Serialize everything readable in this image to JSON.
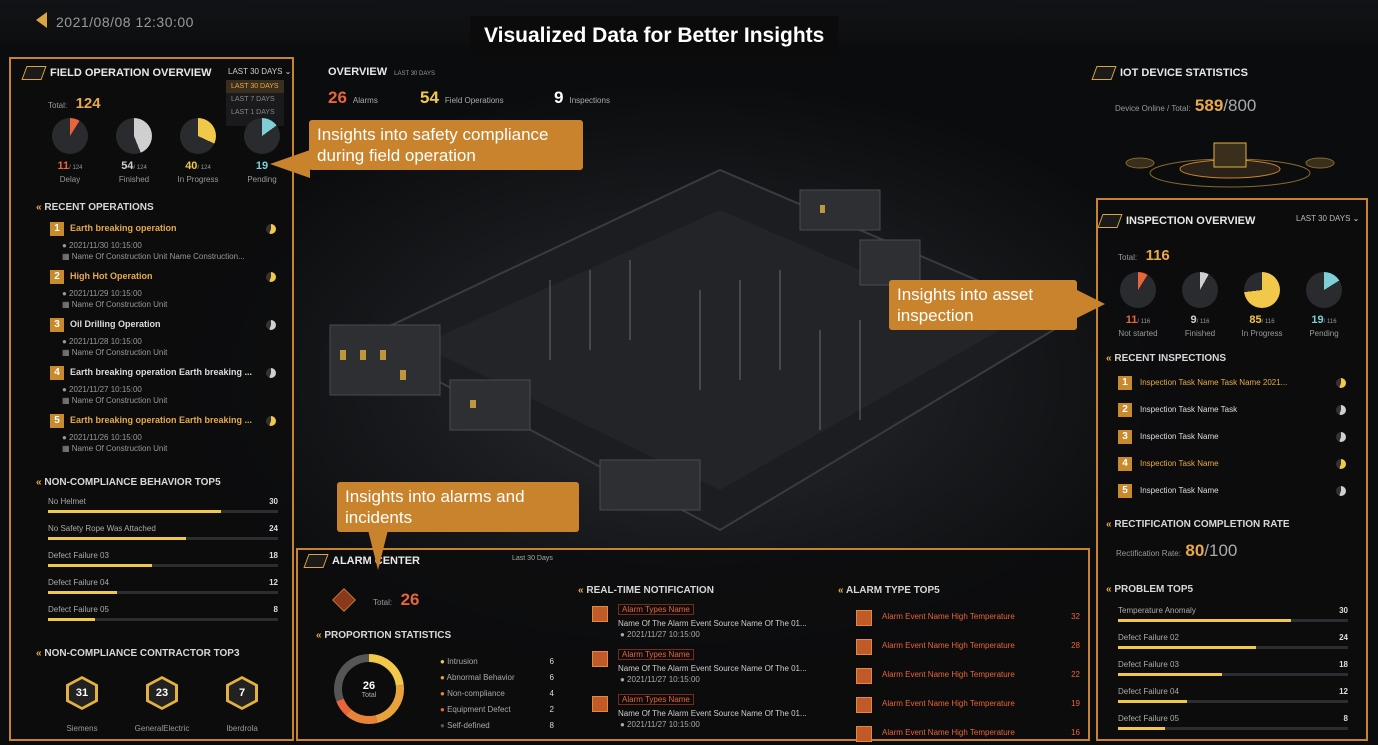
{
  "datetime": "2021/08/08 12:30:00",
  "main_title": "Visualized Data for Better Insights",
  "callouts": {
    "field": "Insights into safety compliance during field operation",
    "asset": "Insights into asset inspection",
    "alarms": "Insights into alarms and incidents"
  },
  "field_operation": {
    "title": "FIELD OPERATION OVERVIEW",
    "period": "LAST 30 DAYS",
    "dropdown_options": [
      "LAST 30 DAYS",
      "LAST 7 DAYS",
      "LAST 1 DAYS"
    ],
    "total_label": "Total:",
    "total": "124",
    "stats": [
      {
        "value": "11",
        "of": "/ 124",
        "label": "Delay",
        "color": "#e8643a",
        "fraction": 0.09
      },
      {
        "value": "54",
        "of": "/ 124",
        "label": "Finished",
        "color": "#cfcfcf",
        "fraction": 0.44
      },
      {
        "value": "40",
        "of": "/ 124",
        "label": "In Progress",
        "color": "#f2c84b",
        "fraction": 0.32
      },
      {
        "value": "19",
        "of": "",
        "label": "Pending",
        "color": "#7fd0d6",
        "fraction": 0.15
      }
    ],
    "recent_title": "RECENT OPERATIONS",
    "recent": [
      {
        "n": "1",
        "name": "Earth breaking operation",
        "time": "2021/11/30 10:15:00",
        "unit": "Name Of Construction Unit Name Construction...",
        "highlight": true
      },
      {
        "n": "2",
        "name": "High Hot Operation",
        "time": "2021/11/29 10:15:00",
        "unit": "Name Of Construction Unit",
        "highlight": true
      },
      {
        "n": "3",
        "name": "Oil Drilling Operation",
        "time": "2021/11/28 10:15:00",
        "unit": "Name Of Construction Unit",
        "highlight": false
      },
      {
        "n": "4",
        "name": "Earth breaking operation Earth breaking ...",
        "time": "2021/11/27 10:15:00",
        "unit": "Name Of Construction Unit",
        "highlight": false
      },
      {
        "n": "5",
        "name": "Earth breaking operation Earth breaking ...",
        "time": "2021/11/26 10:15:00",
        "unit": "Name Of Construction Unit",
        "highlight": true
      }
    ],
    "noncompliance_title": "NON-COMPLIANCE BEHAVIOR TOP5",
    "noncompliance": [
      {
        "label": "No Helmet",
        "value": "30",
        "pct": 1.0
      },
      {
        "label": "No Safety Rope Was Attached",
        "value": "24",
        "pct": 0.8
      },
      {
        "label": "Defect Failure 03",
        "value": "18",
        "pct": 0.6
      },
      {
        "label": "Defect Failure 04",
        "value": "12",
        "pct": 0.4
      },
      {
        "label": "Defect Failure 05",
        "value": "8",
        "pct": 0.27
      }
    ],
    "contractor_title": "NON-COMPLIANCE CONTRACTOR TOP3",
    "contractors": [
      {
        "value": "31",
        "name": "Siemens"
      },
      {
        "value": "23",
        "name": "GeneralElectric"
      },
      {
        "value": "7",
        "name": "Iberdrola"
      }
    ]
  },
  "overview": {
    "title": "OVERVIEW",
    "period": "LAST 30 DAYS",
    "items": [
      {
        "value": "26",
        "label": "Alarms",
        "color": "#e8643a"
      },
      {
        "value": "54",
        "label": "Field Operations",
        "color": "#f2c84b"
      },
      {
        "value": "9",
        "label": "Inspections",
        "color": "#ffffff"
      }
    ]
  },
  "iot": {
    "title": "IOT DEVICE STATISTICS",
    "label": "Device Online / Total:",
    "online": "589",
    "total": "/800"
  },
  "inspection": {
    "title": "INSPECTION OVERVIEW",
    "period": "LAST 30 DAYS",
    "total_label": "Total:",
    "total": "116",
    "stats": [
      {
        "value": "11",
        "of": "/ 116",
        "label": "Not started",
        "color": "#e8643a",
        "fraction": 0.09
      },
      {
        "value": "9",
        "of": "/ 116",
        "label": "Finished",
        "color": "#cfcfcf",
        "fraction": 0.08
      },
      {
        "value": "85",
        "of": "/ 116",
        "label": "In Progress",
        "color": "#f2c84b",
        "fraction": 0.73
      },
      {
        "value": "19",
        "of": "/ 116",
        "label": "Pending",
        "color": "#7fd0d6",
        "fraction": 0.16
      }
    ],
    "recent_title": "RECENT INSPECTIONS",
    "recent": [
      {
        "n": "1",
        "name": "Inspection Task Name Task Name 2021...",
        "highlight": true
      },
      {
        "n": "2",
        "name": "Inspection Task Name Task",
        "highlight": false
      },
      {
        "n": "3",
        "name": "Inspection Task Name",
        "highlight": false
      },
      {
        "n": "4",
        "name": "Inspection Task Name",
        "highlight": true
      },
      {
        "n": "5",
        "name": "Inspection Task Name",
        "highlight": false
      }
    ],
    "rect_title": "RECTIFICATION COMPLETION RATE",
    "rect_label": "Rectification Rate:",
    "rect_value": "80",
    "rect_total": "/100",
    "problem_title": "PROBLEM TOP5",
    "problems": [
      {
        "label": "Temperature Anomaly",
        "value": "30",
        "pct": 1.0
      },
      {
        "label": "Defect Failure 02",
        "value": "24",
        "pct": 0.8
      },
      {
        "label": "Defect Failure 03",
        "value": "18",
        "pct": 0.6
      },
      {
        "label": "Defect Failure 04",
        "value": "12",
        "pct": 0.4
      },
      {
        "label": "Defect Failure 05",
        "value": "8",
        "pct": 0.27
      }
    ]
  },
  "alarm_center": {
    "title": "ALARM CENTER",
    "period": "Last 30 Days",
    "total_label": "Total:",
    "total": "26",
    "proportion_title": "PROPORTION STATISTICS",
    "donut_value": "26",
    "donut_label": "Total",
    "proportions": [
      {
        "label": "Intrusion",
        "value": "6",
        "color": "#f2c84b"
      },
      {
        "label": "Abnormal Behavior",
        "value": "6",
        "color": "#e8a23a"
      },
      {
        "label": "Non-compliance",
        "value": "4",
        "color": "#e8843a"
      },
      {
        "label": "Equipment Defect",
        "value": "2",
        "color": "#e8643a"
      },
      {
        "label": "Self-defined",
        "value": "8",
        "color": "#555555"
      }
    ],
    "realtime_title": "REAL-TIME NOTIFICATION",
    "notifications": [
      {
        "type": "Alarm Types Name",
        "source": "Name Of The Alarm Event Source Name Of The 01...",
        "time": "2021/11/27 10:15:00"
      },
      {
        "type": "Alarm Types Name",
        "source": "Name Of The Alarm Event Source Name Of The 01...",
        "time": "2021/11/27 10:15:00"
      },
      {
        "type": "Alarm Types Name",
        "source": "Name Of The Alarm Event Source Name Of The 01...",
        "time": "2021/11/27 10:15:00"
      }
    ],
    "types_title": "ALARM TYPE TOP5",
    "types": [
      {
        "label": "Alarm Event Name High Temperature",
        "value": "32"
      },
      {
        "label": "Alarm Event Name High Temperature",
        "value": "28"
      },
      {
        "label": "Alarm Event Name High Temperature",
        "value": "22"
      },
      {
        "label": "Alarm Event Name High Temperature",
        "value": "19"
      },
      {
        "label": "Alarm Event Name High Temperature",
        "value": "16"
      }
    ]
  }
}
